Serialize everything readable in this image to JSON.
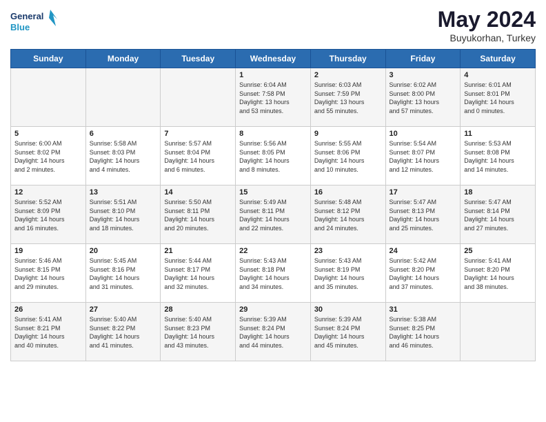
{
  "header": {
    "logo_line1": "General",
    "logo_line2": "Blue",
    "month_year": "May 2024",
    "location": "Buyukorhan, Turkey"
  },
  "days_of_week": [
    "Sunday",
    "Monday",
    "Tuesday",
    "Wednesday",
    "Thursday",
    "Friday",
    "Saturday"
  ],
  "weeks": [
    [
      {
        "day": "",
        "info": ""
      },
      {
        "day": "",
        "info": ""
      },
      {
        "day": "",
        "info": ""
      },
      {
        "day": "1",
        "info": "Sunrise: 6:04 AM\nSunset: 7:58 PM\nDaylight: 13 hours\nand 53 minutes."
      },
      {
        "day": "2",
        "info": "Sunrise: 6:03 AM\nSunset: 7:59 PM\nDaylight: 13 hours\nand 55 minutes."
      },
      {
        "day": "3",
        "info": "Sunrise: 6:02 AM\nSunset: 8:00 PM\nDaylight: 13 hours\nand 57 minutes."
      },
      {
        "day": "4",
        "info": "Sunrise: 6:01 AM\nSunset: 8:01 PM\nDaylight: 14 hours\nand 0 minutes."
      }
    ],
    [
      {
        "day": "5",
        "info": "Sunrise: 6:00 AM\nSunset: 8:02 PM\nDaylight: 14 hours\nand 2 minutes."
      },
      {
        "day": "6",
        "info": "Sunrise: 5:58 AM\nSunset: 8:03 PM\nDaylight: 14 hours\nand 4 minutes."
      },
      {
        "day": "7",
        "info": "Sunrise: 5:57 AM\nSunset: 8:04 PM\nDaylight: 14 hours\nand 6 minutes."
      },
      {
        "day": "8",
        "info": "Sunrise: 5:56 AM\nSunset: 8:05 PM\nDaylight: 14 hours\nand 8 minutes."
      },
      {
        "day": "9",
        "info": "Sunrise: 5:55 AM\nSunset: 8:06 PM\nDaylight: 14 hours\nand 10 minutes."
      },
      {
        "day": "10",
        "info": "Sunrise: 5:54 AM\nSunset: 8:07 PM\nDaylight: 14 hours\nand 12 minutes."
      },
      {
        "day": "11",
        "info": "Sunrise: 5:53 AM\nSunset: 8:08 PM\nDaylight: 14 hours\nand 14 minutes."
      }
    ],
    [
      {
        "day": "12",
        "info": "Sunrise: 5:52 AM\nSunset: 8:09 PM\nDaylight: 14 hours\nand 16 minutes."
      },
      {
        "day": "13",
        "info": "Sunrise: 5:51 AM\nSunset: 8:10 PM\nDaylight: 14 hours\nand 18 minutes."
      },
      {
        "day": "14",
        "info": "Sunrise: 5:50 AM\nSunset: 8:11 PM\nDaylight: 14 hours\nand 20 minutes."
      },
      {
        "day": "15",
        "info": "Sunrise: 5:49 AM\nSunset: 8:11 PM\nDaylight: 14 hours\nand 22 minutes."
      },
      {
        "day": "16",
        "info": "Sunrise: 5:48 AM\nSunset: 8:12 PM\nDaylight: 14 hours\nand 24 minutes."
      },
      {
        "day": "17",
        "info": "Sunrise: 5:47 AM\nSunset: 8:13 PM\nDaylight: 14 hours\nand 25 minutes."
      },
      {
        "day": "18",
        "info": "Sunrise: 5:47 AM\nSunset: 8:14 PM\nDaylight: 14 hours\nand 27 minutes."
      }
    ],
    [
      {
        "day": "19",
        "info": "Sunrise: 5:46 AM\nSunset: 8:15 PM\nDaylight: 14 hours\nand 29 minutes."
      },
      {
        "day": "20",
        "info": "Sunrise: 5:45 AM\nSunset: 8:16 PM\nDaylight: 14 hours\nand 31 minutes."
      },
      {
        "day": "21",
        "info": "Sunrise: 5:44 AM\nSunset: 8:17 PM\nDaylight: 14 hours\nand 32 minutes."
      },
      {
        "day": "22",
        "info": "Sunrise: 5:43 AM\nSunset: 8:18 PM\nDaylight: 14 hours\nand 34 minutes."
      },
      {
        "day": "23",
        "info": "Sunrise: 5:43 AM\nSunset: 8:19 PM\nDaylight: 14 hours\nand 35 minutes."
      },
      {
        "day": "24",
        "info": "Sunrise: 5:42 AM\nSunset: 8:20 PM\nDaylight: 14 hours\nand 37 minutes."
      },
      {
        "day": "25",
        "info": "Sunrise: 5:41 AM\nSunset: 8:20 PM\nDaylight: 14 hours\nand 38 minutes."
      }
    ],
    [
      {
        "day": "26",
        "info": "Sunrise: 5:41 AM\nSunset: 8:21 PM\nDaylight: 14 hours\nand 40 minutes."
      },
      {
        "day": "27",
        "info": "Sunrise: 5:40 AM\nSunset: 8:22 PM\nDaylight: 14 hours\nand 41 minutes."
      },
      {
        "day": "28",
        "info": "Sunrise: 5:40 AM\nSunset: 8:23 PM\nDaylight: 14 hours\nand 43 minutes."
      },
      {
        "day": "29",
        "info": "Sunrise: 5:39 AM\nSunset: 8:24 PM\nDaylight: 14 hours\nand 44 minutes."
      },
      {
        "day": "30",
        "info": "Sunrise: 5:39 AM\nSunset: 8:24 PM\nDaylight: 14 hours\nand 45 minutes."
      },
      {
        "day": "31",
        "info": "Sunrise: 5:38 AM\nSunset: 8:25 PM\nDaylight: 14 hours\nand 46 minutes."
      },
      {
        "day": "",
        "info": ""
      }
    ]
  ]
}
